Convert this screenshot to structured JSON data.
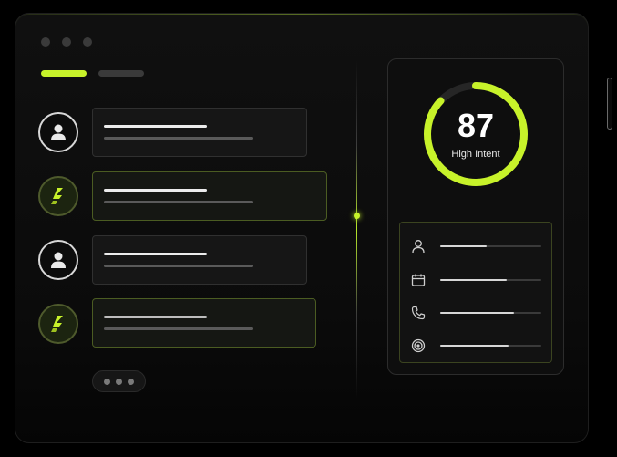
{
  "score": {
    "value": "87",
    "label": "High Intent",
    "progress": 0.87
  },
  "colors": {
    "accent": "#c7f22a",
    "background": "#000000",
    "card": "#161616"
  },
  "list": {
    "items": [
      {
        "icon": "person-icon",
        "highlighted": false
      },
      {
        "icon": "brand-logo-icon",
        "highlighted": true
      },
      {
        "icon": "person-icon",
        "highlighted": false
      },
      {
        "icon": "brand-logo-icon",
        "highlighted": true
      }
    ]
  },
  "metrics": [
    {
      "icon": "user-icon",
      "fill": 0.46
    },
    {
      "icon": "calendar-icon",
      "fill": 0.66
    },
    {
      "icon": "phone-icon",
      "fill": 0.73
    },
    {
      "icon": "target-icon",
      "fill": 0.68
    }
  ]
}
